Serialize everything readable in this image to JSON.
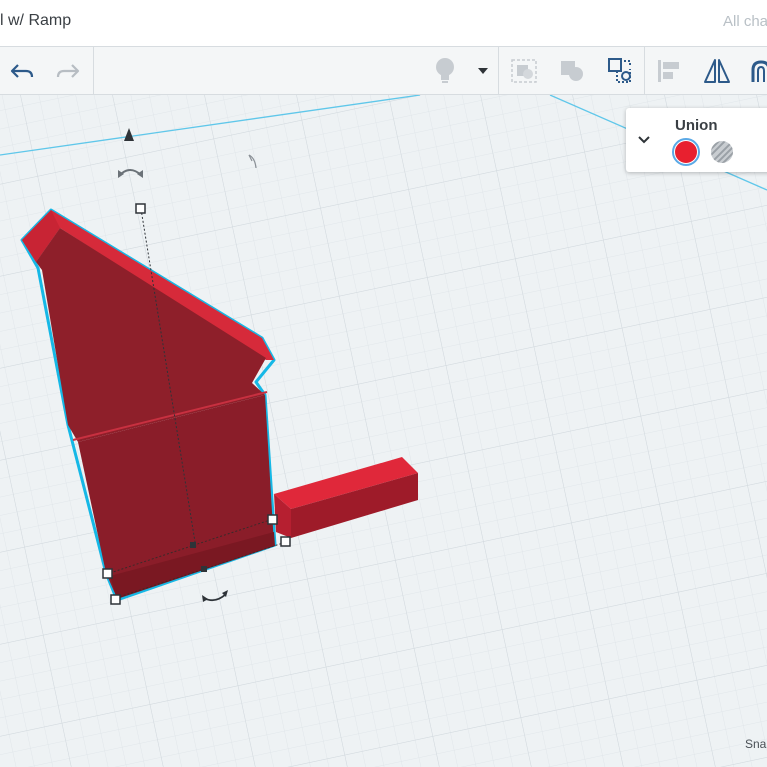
{
  "header": {
    "title": "l w/ Ramp",
    "save_status": "All cha"
  },
  "toolbar": {
    "undo_icon": "undo-arrow-icon",
    "redo_icon": "redo-arrow-icon",
    "tools": [
      "lightbulb-icon",
      "dropdown-caret-icon",
      "group-icon",
      "ungroup-icon",
      "duplicate-icon",
      "align-icon",
      "mirror-icon",
      "magnet-icon"
    ]
  },
  "inspector": {
    "title": "Union",
    "solid_color": "#e8202f",
    "hole_icon": "hole-pattern-icon"
  },
  "workplane": {
    "shape_color_dark": "#8e1e2b",
    "shape_color_light": "#e0283a",
    "selection_outline": "#16b8e6"
  },
  "footer": {
    "snap_label": "Sna"
  }
}
